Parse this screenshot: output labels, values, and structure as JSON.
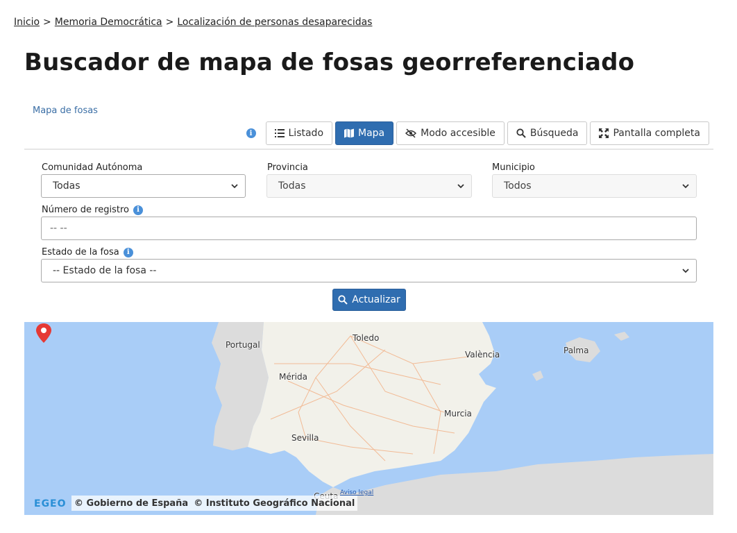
{
  "breadcrumb": {
    "items": [
      "Inicio",
      "Memoria Democrática",
      "Localización de personas desaparecidas"
    ],
    "separator": ">"
  },
  "page_title": "Buscador de mapa de fosas georreferenciado",
  "section_label": "Mapa de fosas",
  "toolbar": {
    "info": "i",
    "listado": "Listado",
    "mapa": "Mapa",
    "accesible": "Modo accesible",
    "busqueda": "Búsqueda",
    "pantalla": "Pantalla completa"
  },
  "form": {
    "comunidad": {
      "label": "Comunidad Autónoma",
      "value": "Todas"
    },
    "provincia": {
      "label": "Provincia",
      "value": "Todas"
    },
    "municipio": {
      "label": "Municipio",
      "value": "Todos"
    },
    "registro": {
      "label": "Número de registro",
      "placeholder": "--  --"
    },
    "estado": {
      "label": "Estado de la fosa",
      "value": "-- Estado de la fosa --"
    },
    "submit": "Actualizar"
  },
  "map": {
    "cities": {
      "portugal": "Portugal",
      "toledo": "Toledo",
      "valencia": "València",
      "palma": "Palma",
      "merida": "Mérida",
      "murcia": "Murcia",
      "sevilla": "Sevilla",
      "ceuta": "Ceuta"
    },
    "attribution": {
      "gobierno": "© Gobierno de España",
      "ign": "© Instituto Geográfico Nacional"
    },
    "aviso": "Aviso legal",
    "logo_text": "EGEO"
  },
  "colors": {
    "primary": "#2f6db0",
    "link": "#3a6ea5",
    "sea": "#a9cdf7",
    "land": "#f2f1ea",
    "foreign_land": "#dcdcdc"
  }
}
